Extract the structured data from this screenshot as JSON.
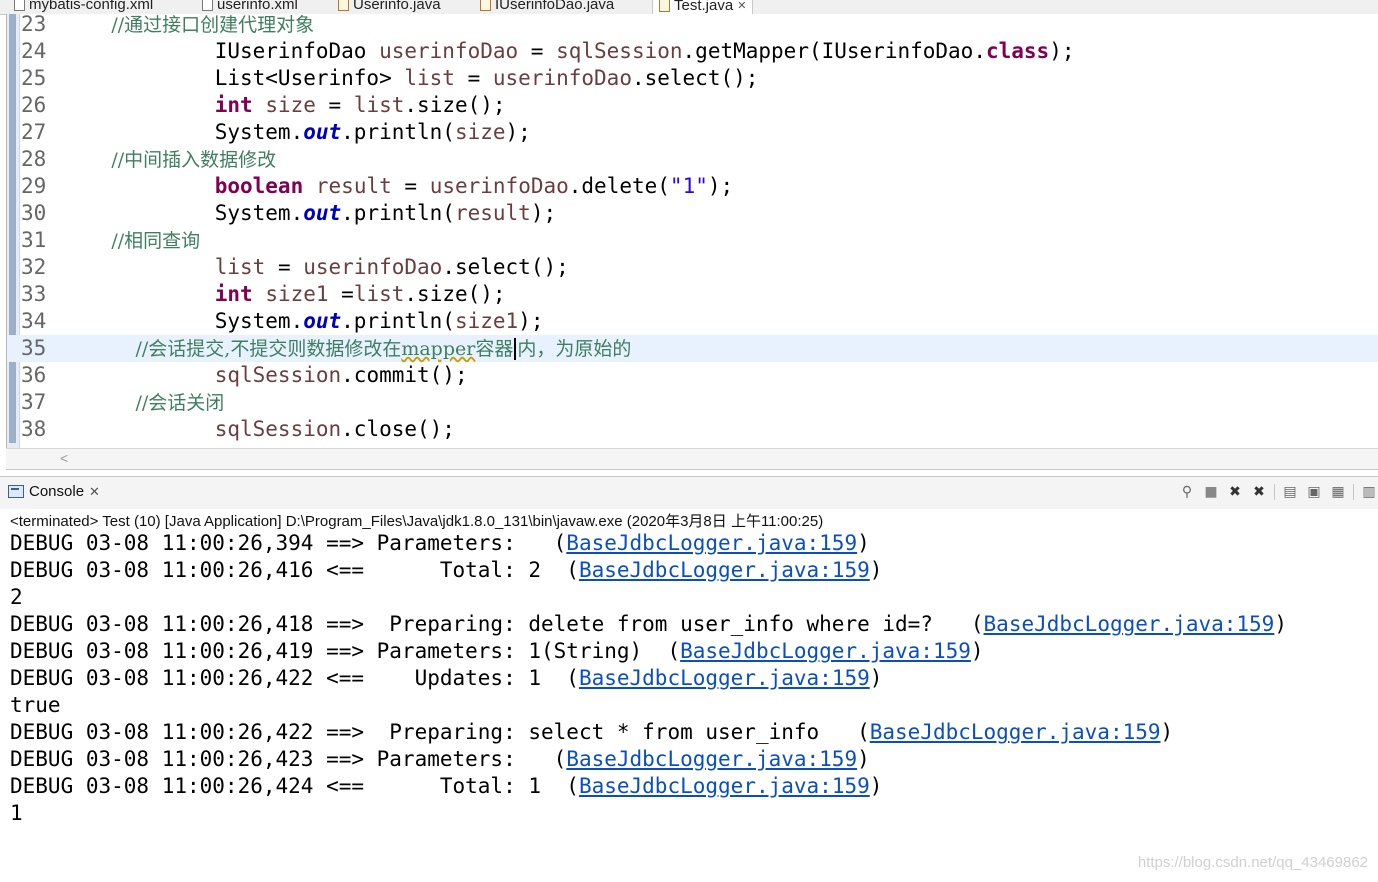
{
  "tabs": [
    {
      "name": "mybatis-config.xml",
      "type": "xml"
    },
    {
      "name": "userinfo.xml",
      "type": "xml"
    },
    {
      "name": "Userinfo.java",
      "type": "java"
    },
    {
      "name": "IUserinfoDao.java",
      "type": "java"
    },
    {
      "name": "Test.java",
      "type": "java",
      "active": true
    }
  ],
  "editor": {
    "lines": [
      {
        "num": "23",
        "parts": [
          {
            "c": "cmt",
            "t": "        //通过接口创建代理对象"
          }
        ]
      },
      {
        "num": "24",
        "parts": [
          {
            "c": "",
            "t": "            IUserinfoDao "
          },
          {
            "c": "var",
            "t": "userinfoDao"
          },
          {
            "c": "",
            "t": " = "
          },
          {
            "c": "var",
            "t": "sqlSession"
          },
          {
            "c": "",
            "t": ".getMapper(IUserinfoDao."
          },
          {
            "c": "kw",
            "t": "class"
          },
          {
            "c": "",
            "t": ");"
          }
        ]
      },
      {
        "num": "25",
        "parts": [
          {
            "c": "",
            "t": "            List<Userinfo> "
          },
          {
            "c": "var",
            "t": "list"
          },
          {
            "c": "",
            "t": " = "
          },
          {
            "c": "var",
            "t": "userinfoDao"
          },
          {
            "c": "",
            "t": ".select();"
          }
        ]
      },
      {
        "num": "26",
        "parts": [
          {
            "c": "",
            "t": "            "
          },
          {
            "c": "kw",
            "t": "int"
          },
          {
            "c": "",
            "t": " "
          },
          {
            "c": "var",
            "t": "size"
          },
          {
            "c": "",
            "t": " = "
          },
          {
            "c": "var",
            "t": "list"
          },
          {
            "c": "",
            "t": ".size();"
          }
        ]
      },
      {
        "num": "27",
        "parts": [
          {
            "c": "",
            "t": "            System."
          },
          {
            "c": "fld",
            "t": "out"
          },
          {
            "c": "",
            "t": ".println("
          },
          {
            "c": "var",
            "t": "size"
          },
          {
            "c": "",
            "t": ");"
          }
        ]
      },
      {
        "num": "28",
        "parts": [
          {
            "c": "cmt",
            "t": "        //中间插入数据修改"
          }
        ]
      },
      {
        "num": "29",
        "parts": [
          {
            "c": "",
            "t": "            "
          },
          {
            "c": "kw",
            "t": "boolean"
          },
          {
            "c": "",
            "t": " "
          },
          {
            "c": "var",
            "t": "result"
          },
          {
            "c": "",
            "t": " = "
          },
          {
            "c": "var",
            "t": "userinfoDao"
          },
          {
            "c": "",
            "t": ".delete("
          },
          {
            "c": "str",
            "t": "\"1\""
          },
          {
            "c": "",
            "t": ");"
          }
        ]
      },
      {
        "num": "30",
        "parts": [
          {
            "c": "",
            "t": "            System."
          },
          {
            "c": "fld",
            "t": "out"
          },
          {
            "c": "",
            "t": ".println("
          },
          {
            "c": "var",
            "t": "result"
          },
          {
            "c": "",
            "t": ");"
          }
        ]
      },
      {
        "num": "31",
        "parts": [
          {
            "c": "cmt",
            "t": "        //相同查询"
          }
        ]
      },
      {
        "num": "32",
        "parts": [
          {
            "c": "",
            "t": "            "
          },
          {
            "c": "var",
            "t": "list"
          },
          {
            "c": "",
            "t": " = "
          },
          {
            "c": "var",
            "t": "userinfoDao"
          },
          {
            "c": "",
            "t": ".select();"
          }
        ]
      },
      {
        "num": "33",
        "parts": [
          {
            "c": "",
            "t": "            "
          },
          {
            "c": "kw",
            "t": "int"
          },
          {
            "c": "",
            "t": " "
          },
          {
            "c": "var",
            "t": "size1"
          },
          {
            "c": "",
            "t": " ="
          },
          {
            "c": "var",
            "t": "list"
          },
          {
            "c": "",
            "t": ".size();"
          }
        ]
      },
      {
        "num": "34",
        "parts": [
          {
            "c": "",
            "t": "            System."
          },
          {
            "c": "fld",
            "t": "out"
          },
          {
            "c": "",
            "t": ".println("
          },
          {
            "c": "var",
            "t": "size1"
          },
          {
            "c": "",
            "t": ");"
          }
        ]
      },
      {
        "num": "35",
        "current": true,
        "parts": [
          {
            "c": "cmt",
            "t": "            //会话提交,不提交则数据修改在"
          },
          {
            "c": "cmt squiggle",
            "t": "mapper"
          },
          {
            "c": "cmt",
            "t": "容器"
          },
          {
            "c": "caret",
            "t": ""
          },
          {
            "c": "cmt",
            "t": "内，为原始的"
          }
        ]
      },
      {
        "num": "36",
        "parts": [
          {
            "c": "",
            "t": "            "
          },
          {
            "c": "var",
            "t": "sqlSession"
          },
          {
            "c": "",
            "t": ".commit();"
          }
        ]
      },
      {
        "num": "37",
        "parts": [
          {
            "c": "cmt",
            "t": "            //会话关闭"
          }
        ]
      },
      {
        "num": "38",
        "parts": [
          {
            "c": "",
            "t": "            "
          },
          {
            "c": "var",
            "t": "sqlSession"
          },
          {
            "c": "",
            "t": ".close();"
          }
        ]
      }
    ]
  },
  "console": {
    "title": "Console",
    "terminated": "<terminated> Test (10) [Java Application] D:\\Program_Files\\Java\\jdk1.8.0_131\\bin\\javaw.exe (2020年3月8日 上午11:00:25)",
    "lines": [
      {
        "text": "DEBUG 03-08 11:00:26,394 ==> Parameters:   (",
        "link": "BaseJdbcLogger.java:159",
        "tail": ")"
      },
      {
        "text": "DEBUG 03-08 11:00:26,416 <==      Total: 2  (",
        "link": "BaseJdbcLogger.java:159",
        "tail": ")"
      },
      {
        "text": "2",
        "link": "",
        "tail": ""
      },
      {
        "text": "DEBUG 03-08 11:00:26,418 ==>  Preparing: delete from user_info where id=?   (",
        "link": "BaseJdbcLogger.java:159",
        "tail": ")"
      },
      {
        "text": "DEBUG 03-08 11:00:26,419 ==> Parameters: 1(String)  (",
        "link": "BaseJdbcLogger.java:159",
        "tail": ")"
      },
      {
        "text": "DEBUG 03-08 11:00:26,422 <==    Updates: 1  (",
        "link": "BaseJdbcLogger.java:159",
        "tail": ")"
      },
      {
        "text": "true",
        "link": "",
        "tail": ""
      },
      {
        "text": "DEBUG 03-08 11:00:26,422 ==>  Preparing: select * from user_info   (",
        "link": "BaseJdbcLogger.java:159",
        "tail": ")"
      },
      {
        "text": "DEBUG 03-08 11:00:26,423 ==> Parameters:   (",
        "link": "BaseJdbcLogger.java:159",
        "tail": ")"
      },
      {
        "text": "DEBUG 03-08 11:00:26,424 <==      Total: 1  (",
        "link": "BaseJdbcLogger.java:159",
        "tail": ")"
      },
      {
        "text": "1",
        "link": "",
        "tail": ""
      }
    ]
  },
  "watermark": "https://blog.csdn.net/qq_43469862",
  "icons": {
    "toolbar": [
      "pin-console-icon",
      "terminate-icon",
      "remove-launch-icon",
      "remove-all-launches-icon",
      "scroll-lock-icon",
      "show-on-output-icon",
      "display-console-icon",
      "open-console-icon"
    ]
  },
  "colors": {
    "keyword": "#7f0055",
    "variable": "#6a3e3e",
    "field": "#0000c0",
    "string": "#2a00ff",
    "comment": "#3f7f5f",
    "link": "#0b4fbf",
    "current_line": "#e8f2fe"
  }
}
